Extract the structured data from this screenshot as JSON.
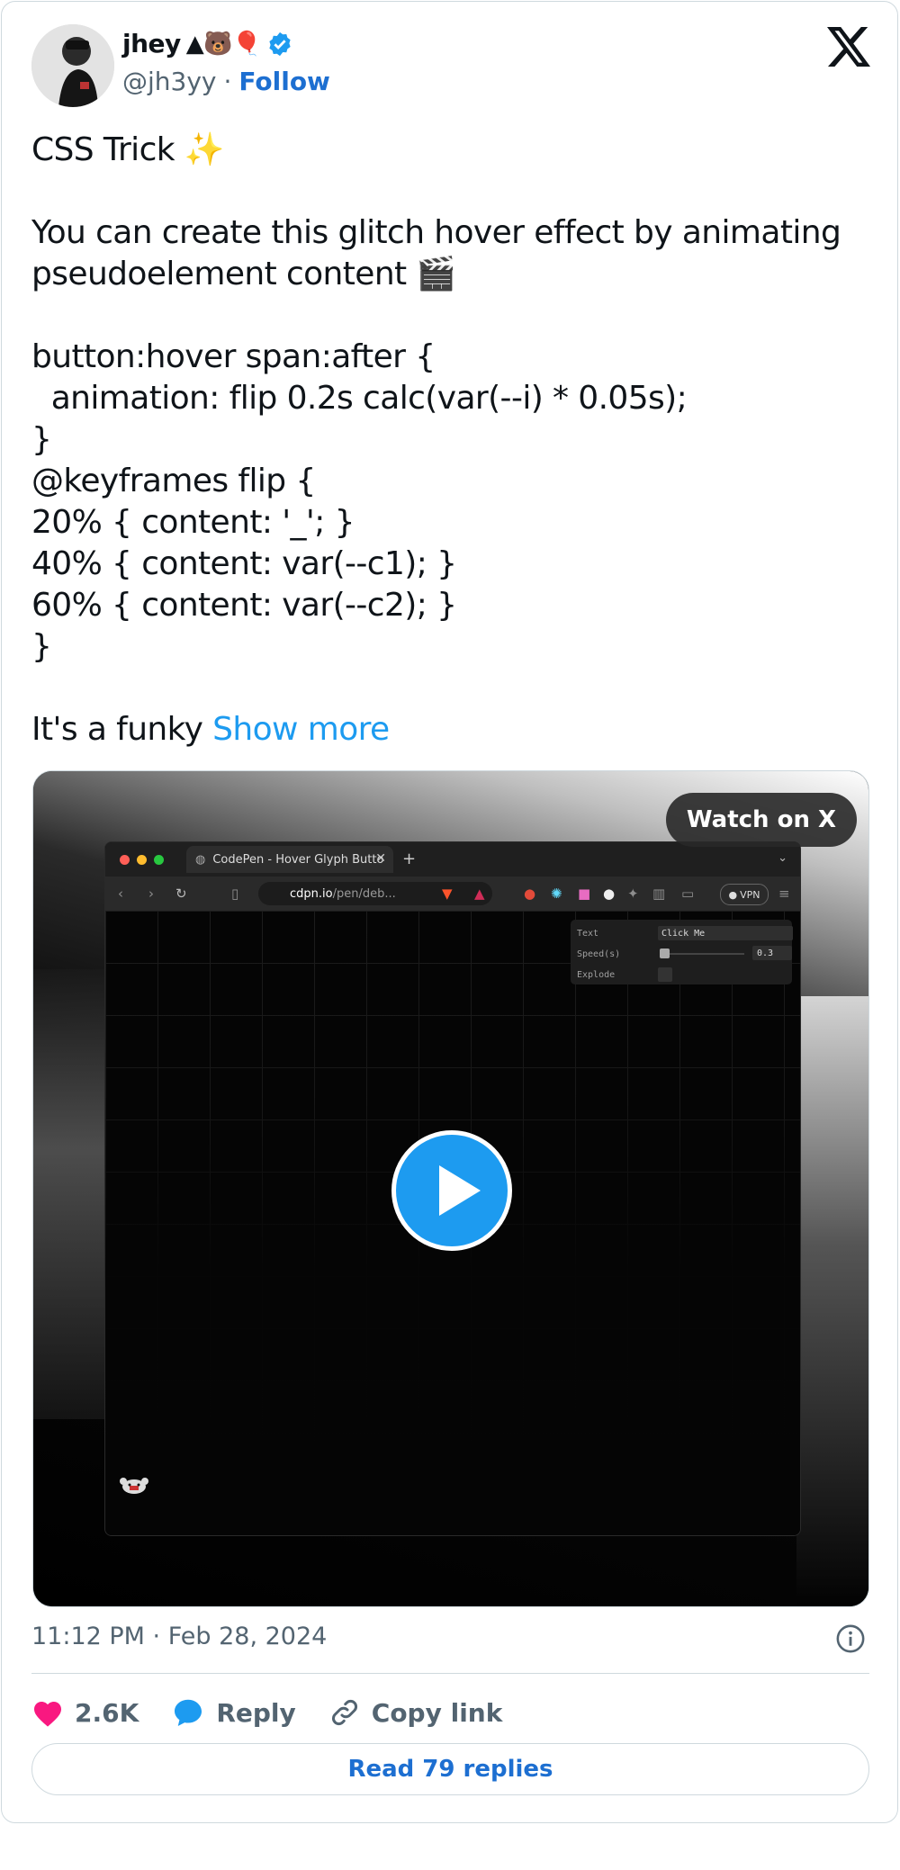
{
  "author": {
    "name": "jhey",
    "name_emojis": "▲🐻🎈",
    "handle": "@jh3yy",
    "separator": "·",
    "follow_label": "Follow"
  },
  "tweet": {
    "text": "CSS Trick ✨\n\nYou can create this glitch hover effect by animating pseudoelement content 🎬\n\nbutton:hover span:after {\n  animation: flip 0.2s calc(var(--i) * 0.05s);\n}\n@keyframes flip {\n20% { content: '_'; }\n40% { content: var(--c1); }\n60% { content: var(--c2); }\n}\n\nIt's a funky ",
    "show_more": "Show more"
  },
  "media": {
    "watch_label": "Watch on X",
    "browser": {
      "tab_title": "CodePen - Hover Glyph Butto",
      "url_host": "cdpn.io",
      "url_path": "/pen/deb...",
      "vpn_label": "VPN"
    },
    "panel": {
      "text_label": "Text",
      "text_value": "Click Me",
      "speed_label": "Speed(s)",
      "speed_value": "0.3",
      "explode_label": "Explode"
    }
  },
  "timestamp": "11:12 PM · Feb 28, 2024",
  "actions": {
    "likes": "2.6K",
    "reply": "Reply",
    "copy_link": "Copy link"
  },
  "read_replies": "Read 79 replies",
  "colors": {
    "accent": "#1d9bf0",
    "link": "#1d6fd1",
    "heart": "#f91880",
    "muted": "#536471"
  }
}
